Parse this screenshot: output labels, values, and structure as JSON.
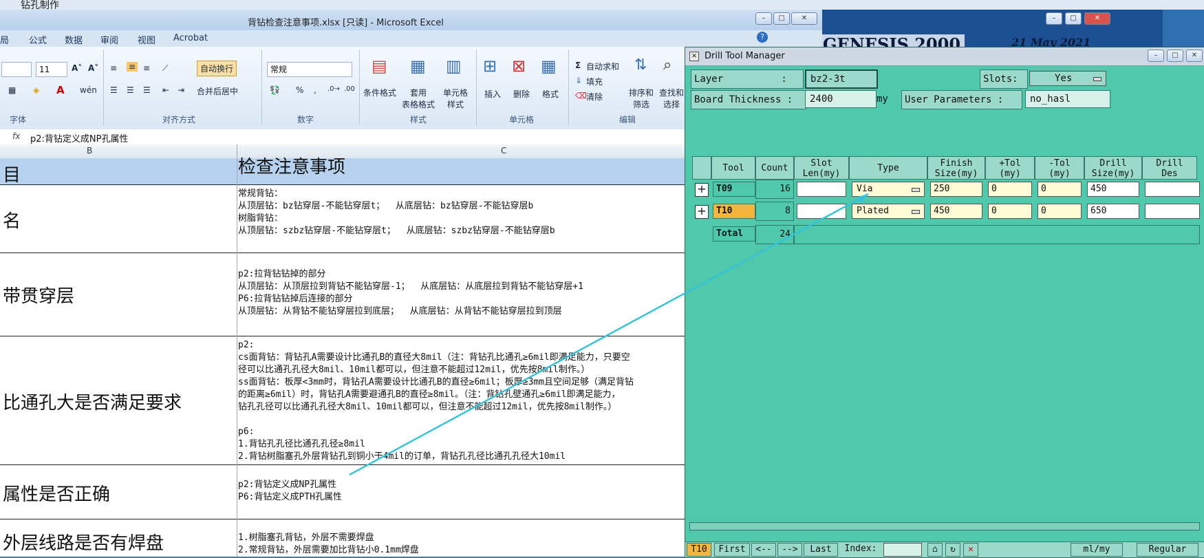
{
  "desktop": {
    "top_item": "钻孔制作"
  },
  "excel": {
    "title": "背钻检查注意事项.xlsx [只读] - Microsoft Excel",
    "tabs": [
      "局",
      "公式",
      "数据",
      "审阅",
      "视图",
      "Acrobat"
    ],
    "ribbon": {
      "font_size": "11",
      "wrap_text": "自动换行",
      "merge_center": "合并后居中",
      "number_format": "常规",
      "percent": "%",
      "comma": ",",
      "conditional_format": "条件格式",
      "table_format": "套用\n表格格式",
      "cell_style": "单元格\n样式",
      "insert": "插入",
      "delete": "删除",
      "format": "格式",
      "autosum": "自动求和",
      "fill": "填充",
      "clear": "清除",
      "sort_filter": "排序和\n筛选",
      "find_select": "查找和\n选择",
      "groups": [
        "字体",
        "对齐方式",
        "数字",
        "样式",
        "单元格",
        "编辑"
      ]
    },
    "formula_bar": {
      "fx": "fx",
      "value": "p2:背钻定义成NP孔属性"
    },
    "columns": [
      "B",
      "C"
    ],
    "header_row": {
      "b": "目",
      "c": "检查注意事项"
    },
    "rows": [
      {
        "b": "名",
        "c": "常规背钻：\n从顶层钻：bz钻穿层-不能钻穿层t；  从底层钻：bz钻穿层-不能钻穿层b\n树脂背钻：\n从顶层钻：szbz钻穿层-不能钻穿层t；  从底层钻：szbz钻穿层-不能钻穿层b"
      },
      {
        "b": "带贯穿层",
        "c": "p2:拉背钻钻掉的部分\n从顶层钻：从顶层拉到背钻不能钻穿层-1；  从底层钻：从底层拉到背钻不能钻穿层+1\nP6:拉背钻钻掉后连接的部分\n从顶层钻：从背钻不能钻穿层拉到底层；  从底层钻：从背钻不能钻穿层拉到顶层"
      },
      {
        "b": "比通孔大是否满足要求",
        "c": "p2:\ncs面背钻：背钻孔A需要设计比通孔B的直径大8mil（注：背钻孔比通孔≥6mil即满足能力，只要空\n径可以比通孔孔径大8mil、10mil都可以，但注意不能超过12mil，优先按8mil制作。）\nss面背钻：板厚<3mm时，背钻孔A需要设计比通孔B的直径≥6mil；板厚≥3mm且空间足够（满足背钻\n的距离≥6mil）时，背钻孔A需要避通孔B的直径≥8mil。（注：背钻孔壁通孔≥6mil即满足能力，\n钻孔孔径可以比通孔孔径大8mil、10mil都可以，但注意不能超过12mil，优先按8mil制作。）\n\np6:\n1.背钻孔孔径比通孔孔径≥8mil\n2.背钻树脂塞孔外层背钻孔到铜小于4mil的订单，背钻孔孔径比通孔孔径大10mil"
      },
      {
        "b": "属性是否正确",
        "c": "p2:背钻定义成NP孔属性\nP6:背钻定义成PTH孔属性"
      },
      {
        "b": "外层线路是否有焊盘",
        "c": "1.树脂塞孔背钻，外层不需要焊盘\n2.常规背钻，外层需要加比背钻小0.1mm焊盘"
      }
    ]
  },
  "genesis": {
    "title": "GENESIS 2000",
    "date": "21 May 2021"
  },
  "drill_tool_manager": {
    "title": "Drill Tool Manager",
    "layer_label": "Layer          :",
    "layer_value": "bz2-3t",
    "slots_label": "Slots:",
    "slots_value": "Yes",
    "board_thickness_label": "Board Thickness :",
    "board_thickness_value": "2400",
    "board_thickness_unit": "my",
    "user_params_label": "User Parameters :",
    "user_params_value": "no_hasl",
    "headers": [
      "Tool",
      "Count",
      "Slot\nLen(my)",
      "Type",
      "Finish\nSize(my)",
      "+Tol\n(my)",
      "-Tol\n(my)",
      "Drill\nSize(my)",
      "Drill\nDes"
    ],
    "tools": [
      {
        "tool": "T09",
        "count": "16",
        "type": "Via",
        "finish": "250",
        "plus_tol": "0",
        "minus_tol": "0",
        "drill": "450",
        "color": "#4fc8ac"
      },
      {
        "tool": "T10",
        "count": "8",
        "type": "Plated",
        "finish": "450",
        "plus_tol": "0",
        "minus_tol": "0",
        "drill": "650",
        "color": "#f5b640"
      }
    ],
    "total_label": "Total",
    "total_count": "24",
    "bottom": {
      "current_tool": "T10",
      "first": "First",
      "prev": "<--",
      "next": "-->",
      "last": "Last",
      "index_label": "Index:",
      "units": "ml/my",
      "mode": "Regular"
    }
  }
}
